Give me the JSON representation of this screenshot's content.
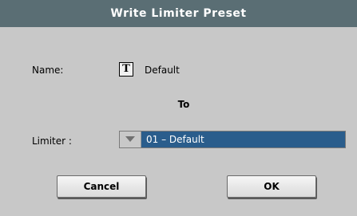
{
  "dialog": {
    "title": "Write Limiter Preset",
    "name_label": "Name:",
    "name_value": "Default",
    "to_label": "To",
    "limiter_label": "Limiter :",
    "limiter_selected": "01 – Default",
    "cancel_label": "Cancel",
    "ok_label": "OK"
  },
  "icons": {
    "text_edit_icon": "T",
    "dropdown_arrow_icon": "triangle-down"
  },
  "colors": {
    "titlebar": "#5a6e74",
    "background": "#c8c8c8",
    "selection": "#2a5d8c"
  }
}
